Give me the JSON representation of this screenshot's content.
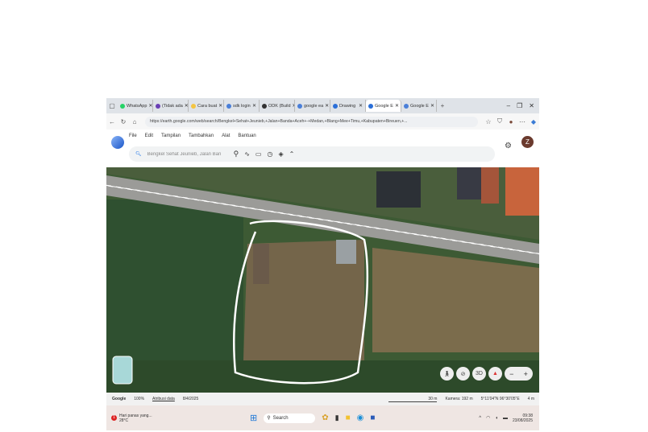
{
  "browser": {
    "tabs": [
      {
        "label": "WhatsApp",
        "color": "#25d366"
      },
      {
        "label": "(Tidak ada",
        "color": "#6a3fb5"
      },
      {
        "label": "Cara buat",
        "color": "#f4c542"
      },
      {
        "label": "sdk login",
        "color": "#4a7fd8"
      },
      {
        "label": "ODK (Build",
        "color": "#333333"
      },
      {
        "label": "google ea",
        "color": "#4a7fd8"
      },
      {
        "label": "Drawing",
        "color": "#2b6fd8"
      },
      {
        "label": "Google E",
        "color": "#2b6fd8",
        "active": true
      },
      {
        "label": "Google E",
        "color": "#4a7fd8"
      }
    ],
    "new_tab": "+",
    "url": "https://earth.google.com/web/search/Bengkel+Sehat+Jeunieb,+Jalan+Banda+Aceh+-+Medan,+Blang+Mee+Timu,+Kabupaten+Bireuen,+..."
  },
  "menu": [
    "File",
    "Edit",
    "Tampilan",
    "Tambahkan",
    "Alat",
    "Bantuan"
  ],
  "search": {
    "value": "Bengkel Sehat Jeunieb, Jalan Ban"
  },
  "avatar": "Z",
  "map_controls": {
    "tilt": "3D",
    "zoom_out": "−",
    "zoom_in": "+"
  },
  "status": {
    "logo": "Google",
    "scale_pct": "100%",
    "attribution": "Atribusi data",
    "date": "8/4/2025",
    "scale": "30 m",
    "camera": "Kamera: 192 m",
    "coords": "5°11'04\"N 96°30'05\"E",
    "elev": "4 m"
  },
  "taskbar": {
    "weather_text": "Hari panas yang...",
    "temp": "28°C",
    "badge": "1",
    "search": "Search",
    "time": "09:38",
    "date": "23/08/2025"
  }
}
